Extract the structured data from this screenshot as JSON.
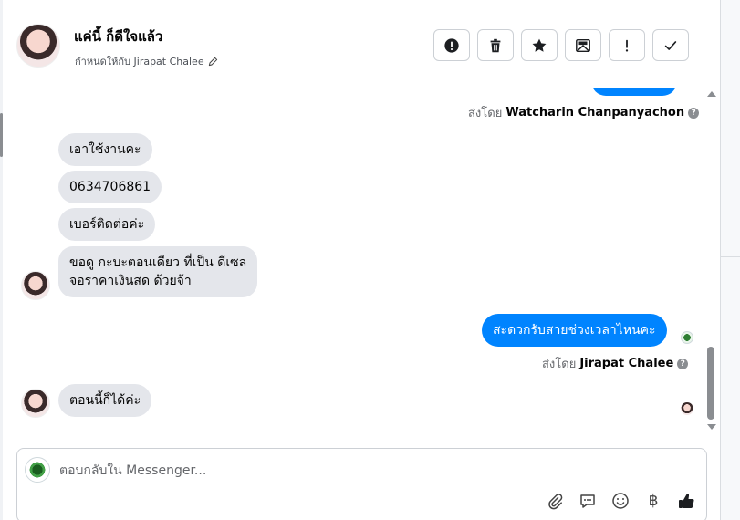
{
  "header": {
    "contact_name": "แค่นี้ ก็ดีใจแล้ว",
    "assigned_text": "กำหนดให้กับ Jirapat Chalee"
  },
  "actions": [
    {
      "name": "spam-button",
      "icon": "exclamation-circle-icon"
    },
    {
      "name": "delete-button",
      "icon": "trash-icon"
    },
    {
      "name": "star-button",
      "icon": "star-icon"
    },
    {
      "name": "mark-unread-button",
      "icon": "envelope-icon"
    },
    {
      "name": "follow-up-button",
      "icon": "exclamation-icon"
    },
    {
      "name": "mark-done-button",
      "icon": "check-icon"
    }
  ],
  "thread": {
    "sent_by_prefix": "ส่งโดย",
    "top_sender": "Watcharin Chanpanyachon",
    "messages_in_1": "เอาใช้งานคะ",
    "messages_in_2": "0634706861",
    "messages_in_3": "เบอร์ติดต่อค่ะ",
    "messages_in_4a": "ขอดู กะบะตอนเดียว ที่เป็น ดีเซล",
    "messages_in_4b": "จอราคาเงินสด ด้วยจ้า",
    "message_out_1": "สะดวกรับสายช่วงเวลาไหนคะ",
    "out_sender": "Jirapat Chalee",
    "messages_in_5": "ตอนนี้ก็ได้ค่ะ"
  },
  "composer": {
    "placeholder": "ตอบกลับใน Messenger...",
    "tools": [
      "paperclip-icon",
      "saved-reply-icon",
      "emoji-icon",
      "baht-icon",
      "like-icon"
    ],
    "baht_symbol": "฿"
  },
  "colors": {
    "accent": "#0084ff",
    "bubble_in": "#e4e6eb",
    "border": "#dadde1"
  }
}
